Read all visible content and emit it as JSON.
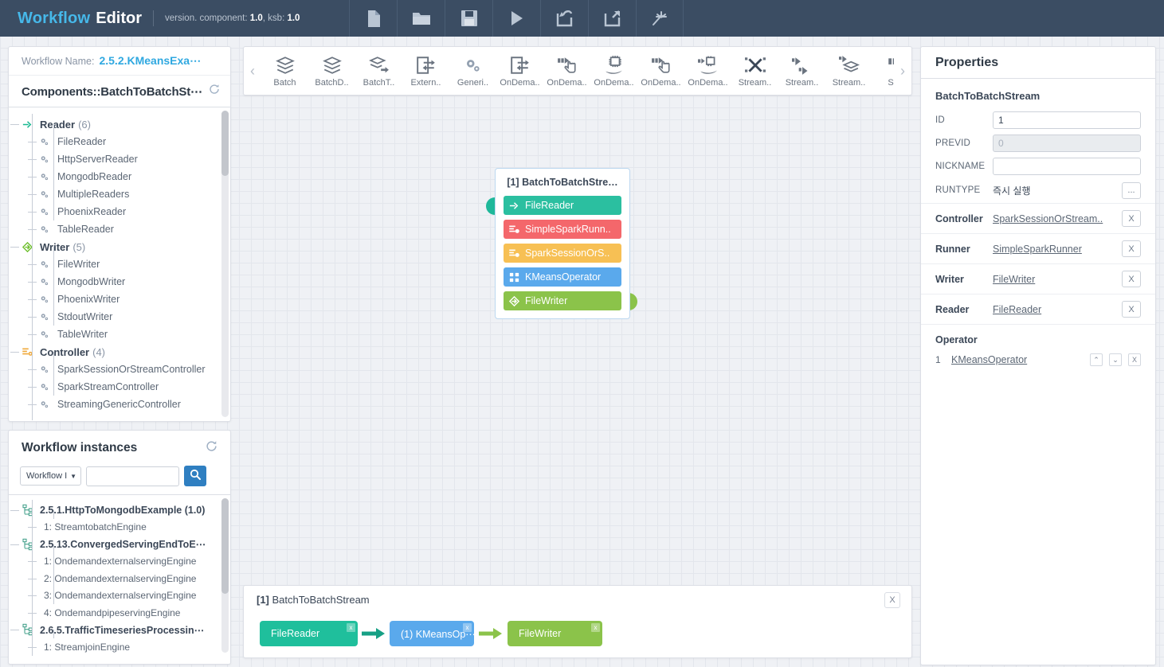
{
  "app": {
    "brand_primary": "Workflow",
    "brand_secondary": "Editor",
    "version_label": "version. component:",
    "version_component": "1.0",
    "version_ksb_label": ", ksb:",
    "version_ksb": "1.0",
    "accent_blue": "#46b8e9",
    "topbar_bg": "#3b4d63"
  },
  "toolbar": {
    "buttons": [
      {
        "name": "new-file-icon",
        "title": "New"
      },
      {
        "name": "open-folder-icon",
        "title": "Open"
      },
      {
        "name": "save-icon",
        "title": "Save"
      },
      {
        "name": "run-play-icon",
        "title": "Run"
      },
      {
        "name": "import-icon",
        "title": "Import"
      },
      {
        "name": "export-icon",
        "title": "Export"
      },
      {
        "name": "magic-wand-icon",
        "title": "Auto"
      }
    ]
  },
  "left_panel": {
    "workflow_name_label": "Workflow Name:",
    "workflow_name_value": "2.5.2.KMeansExa⋯",
    "components_title": "Components::BatchToBatchSt⋯",
    "refresh_icon": "refresh-icon",
    "tree": [
      {
        "type": "group",
        "icon": "reader-arrow-icon",
        "label": "Reader",
        "count": "(6)"
      },
      {
        "type": "leaf",
        "icon": "gears-icon",
        "label": "FileReader"
      },
      {
        "type": "leaf",
        "icon": "gears-icon",
        "label": "HttpServerReader"
      },
      {
        "type": "leaf",
        "icon": "gears-icon",
        "label": "MongodbReader"
      },
      {
        "type": "leaf",
        "icon": "gears-icon",
        "label": "MultipleReaders"
      },
      {
        "type": "leaf",
        "icon": "gears-icon",
        "label": "PhoenixReader"
      },
      {
        "type": "leaf",
        "icon": "gears-icon",
        "label": "TableReader"
      },
      {
        "type": "group",
        "icon": "writer-diamond-icon",
        "label": "Writer",
        "count": "(5)"
      },
      {
        "type": "leaf",
        "icon": "gears-icon",
        "label": "FileWriter"
      },
      {
        "type": "leaf",
        "icon": "gears-icon",
        "label": "MongodbWriter"
      },
      {
        "type": "leaf",
        "icon": "gears-icon",
        "label": "PhoenixWriter"
      },
      {
        "type": "leaf",
        "icon": "gears-icon",
        "label": "StdoutWriter"
      },
      {
        "type": "leaf",
        "icon": "gears-icon",
        "label": "TableWriter"
      },
      {
        "type": "group",
        "icon": "controller-icon",
        "label": "Controller",
        "count": "(4)"
      },
      {
        "type": "leaf",
        "icon": "gears-icon",
        "label": "SparkSessionOrStreamController"
      },
      {
        "type": "leaf",
        "icon": "gears-icon",
        "label": "SparkStreamController"
      },
      {
        "type": "leaf",
        "icon": "gears-icon",
        "label": "StreamingGenericController"
      }
    ]
  },
  "instances_panel": {
    "title": "Workflow instances",
    "refresh_icon": "refresh-icon",
    "filter_selected": "Workflow I",
    "search_value": "",
    "search_placeholder": "",
    "search_button_icon": "search-icon",
    "items": [
      {
        "type": "group",
        "label": "2.5.1.HttpToMongodbExample (1.0)"
      },
      {
        "type": "leaf",
        "label": "1: StreamtobatchEngine"
      },
      {
        "type": "group",
        "label": "2.5.13.ConvergedServingEndToE⋯"
      },
      {
        "type": "leaf",
        "label": "1: OndemandexternalservingEngine"
      },
      {
        "type": "leaf",
        "label": "2: OndemandexternalservingEngine"
      },
      {
        "type": "leaf",
        "label": "3: OndemandexternalservingEngine"
      },
      {
        "type": "leaf",
        "label": "4: OndemandpipeservingEngine"
      },
      {
        "type": "group",
        "label": "2.6.5.TrafficTimeseriesProcessin⋯"
      },
      {
        "type": "leaf",
        "label": "1: StreamjoinEngine"
      }
    ]
  },
  "palette": {
    "prev_icon": "chevron-left-icon",
    "next_icon": "chevron-right-icon",
    "items": [
      {
        "label": "Batch",
        "icon": "layers-icon"
      },
      {
        "label": "BatchD..",
        "icon": "layers-icon"
      },
      {
        "label": "BatchT..",
        "icon": "layers-arrow-icon"
      },
      {
        "label": "Extern..",
        "icon": "external-box-icon"
      },
      {
        "label": "Generi..",
        "icon": "gears-icon"
      },
      {
        "label": "OnDema..",
        "icon": "external-box-icon"
      },
      {
        "label": "OnDema..",
        "icon": "hand-click-icon"
      },
      {
        "label": "OnDema..",
        "icon": "chip-hand-icon"
      },
      {
        "label": "OnDema..",
        "icon": "hand-click-icon"
      },
      {
        "label": "OnDema..",
        "icon": "chip-arrow-icon"
      },
      {
        "label": "Stream..",
        "icon": "stream-cross-icon"
      },
      {
        "label": "Stream..",
        "icon": "double-arrow-icon"
      },
      {
        "label": "Stream..",
        "icon": "stream-layers-icon"
      },
      {
        "label": "Stre",
        "icon": "stream-pause-icon"
      }
    ]
  },
  "canvas_node": {
    "title": "[1] BatchToBatchStre…",
    "in_port_color": "#1fb89a",
    "out_port_color": "#8bc34a",
    "rows": [
      {
        "label": "FileReader",
        "color": "#2bbfa0",
        "icon": "reader-arrow-icon"
      },
      {
        "label": "SimpleSparkRunn..",
        "color": "#f4676b",
        "icon": "runner-icon"
      },
      {
        "label": "SparkSessionOrS..",
        "color": "#f7c košt",
        "icon": "controller-icon"
      },
      {
        "label": "KMeansOperator",
        "color": "#5aa9ec",
        "icon": "operator-grid-icon"
      },
      {
        "label": "FileWriter",
        "color": "#8bc34a",
        "icon": "writer-diamond-icon"
      }
    ]
  },
  "properties": {
    "title": "Properties",
    "subtitle": "BatchToBatchStream",
    "fields": [
      {
        "key": "ID",
        "value": "1",
        "disabled": false
      },
      {
        "key": "PREVID",
        "value": "0",
        "disabled": true
      },
      {
        "key": "NICKNAME",
        "value": "",
        "disabled": false
      }
    ],
    "runtype_key": "RUNTYPE",
    "runtype_value": "즉시 실행",
    "runtype_button": "...",
    "links": [
      {
        "key": "Controller",
        "value": "SparkSessionOrStream..",
        "remove": "X"
      },
      {
        "key": "Runner",
        "value": "SimpleSparkRunner",
        "remove": "X"
      },
      {
        "key": "Writer",
        "value": "FileWriter",
        "remove": "X"
      },
      {
        "key": "Reader",
        "value": "FileReader",
        "remove": "X"
      }
    ],
    "operator_title": "Operator",
    "operators": [
      {
        "index": "1",
        "value": "KMeansOperator",
        "up": "⌃",
        "down": "⌄",
        "remove": "X"
      }
    ]
  },
  "flow_panel": {
    "prefix": "[1]",
    "title": "BatchToBatchStream",
    "close_label": "X",
    "nodes": [
      {
        "label": "FileReader",
        "color": "#1fbf9c",
        "close": "x"
      },
      {
        "label": "(1) KMeansOp⋯",
        "color": "#5aa9ec",
        "close": "x"
      },
      {
        "label": "FileWriter",
        "color": "#8bc34a",
        "close": "x"
      }
    ],
    "arrows": [
      {
        "color": "#16a085"
      },
      {
        "color": "#8bc34a"
      }
    ]
  }
}
